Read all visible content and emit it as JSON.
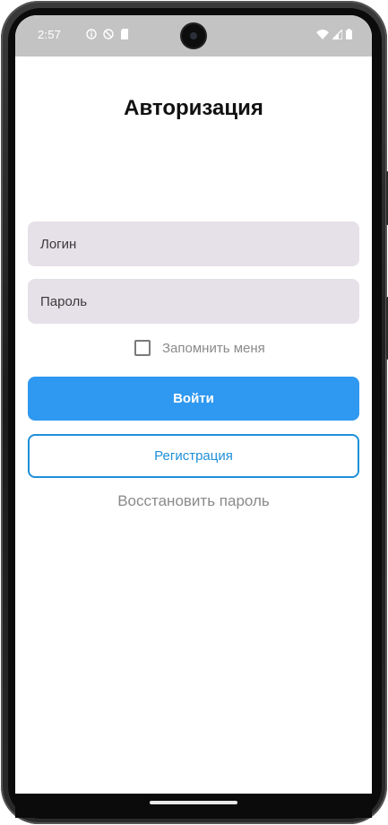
{
  "status_bar": {
    "time": "2:57",
    "left_icons": [
      "info-circle-icon",
      "do-not-disturb-icon",
      "sd-card-icon"
    ],
    "right_icons": [
      "wifi-icon",
      "signal-icon",
      "battery-icon"
    ]
  },
  "auth": {
    "title": "Авторизация",
    "login_placeholder": "Логин",
    "password_placeholder": "Пароль",
    "remember_label": "Запомнить меня",
    "remember_checked": false,
    "login_button": "Войти",
    "register_button": "Регистрация",
    "restore_link": "Восстановить пароль"
  },
  "colors": {
    "primary": "#2f98f0",
    "outline": "#1e90d8",
    "field_bg": "#e6e0e8",
    "status_bar": "#c3c3c3"
  }
}
